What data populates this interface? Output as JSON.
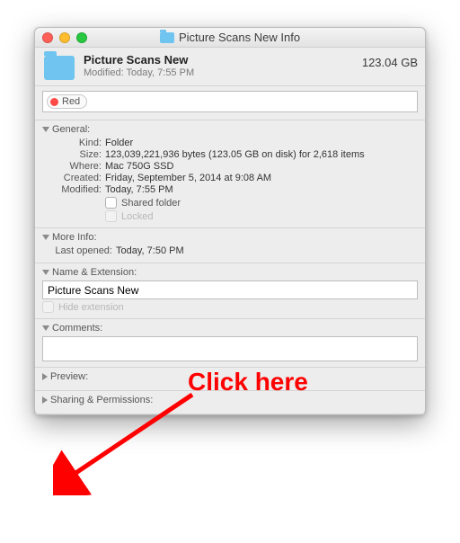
{
  "titlebar": {
    "title": "Picture Scans New Info"
  },
  "header": {
    "name": "Picture Scans New",
    "modified": "Modified: Today, 7:55 PM",
    "size": "123.04 GB"
  },
  "tag": {
    "label": "Red"
  },
  "sections": {
    "general": {
      "title": "General:",
      "kind_label": "Kind:",
      "kind_value": "Folder",
      "size_label": "Size:",
      "size_value": "123,039,221,936 bytes (123.05 GB on disk) for 2,618 items",
      "where_label": "Where:",
      "where_value": "Mac 750G SSD",
      "created_label": "Created:",
      "created_value": "Friday, September 5, 2014 at 9:08 AM",
      "modified_label": "Modified:",
      "modified_value": "Today, 7:55 PM",
      "shared_label": "Shared folder",
      "locked_label": "Locked"
    },
    "more_info": {
      "title": "More Info:",
      "last_opened_label": "Last opened:",
      "last_opened_value": "Today, 7:50 PM"
    },
    "name_ext": {
      "title": "Name & Extension:",
      "value": "Picture Scans New",
      "hide_ext_label": "Hide extension"
    },
    "comments": {
      "title": "Comments:"
    },
    "preview": {
      "title": "Preview:"
    },
    "sharing": {
      "title": "Sharing & Permissions:"
    }
  },
  "annotation": {
    "text": "Click here"
  }
}
